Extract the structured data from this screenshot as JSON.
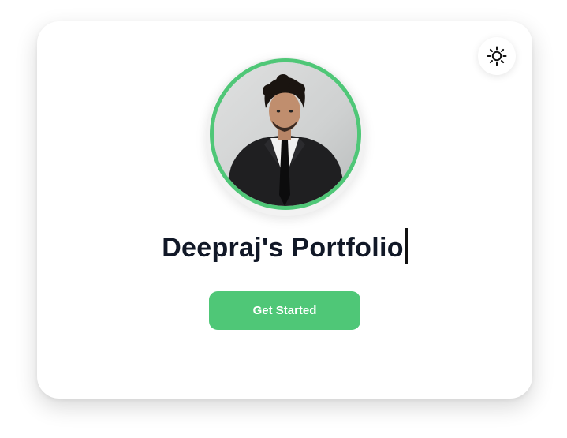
{
  "header": {
    "theme_toggle_icon": "sun-icon"
  },
  "profile": {
    "avatar_icon": "profile-photo",
    "ring_color": "#4fc777"
  },
  "hero": {
    "title": "Deepraj's Portfolio"
  },
  "actions": {
    "get_started_label": "Get Started",
    "button_color": "#4fc777"
  }
}
